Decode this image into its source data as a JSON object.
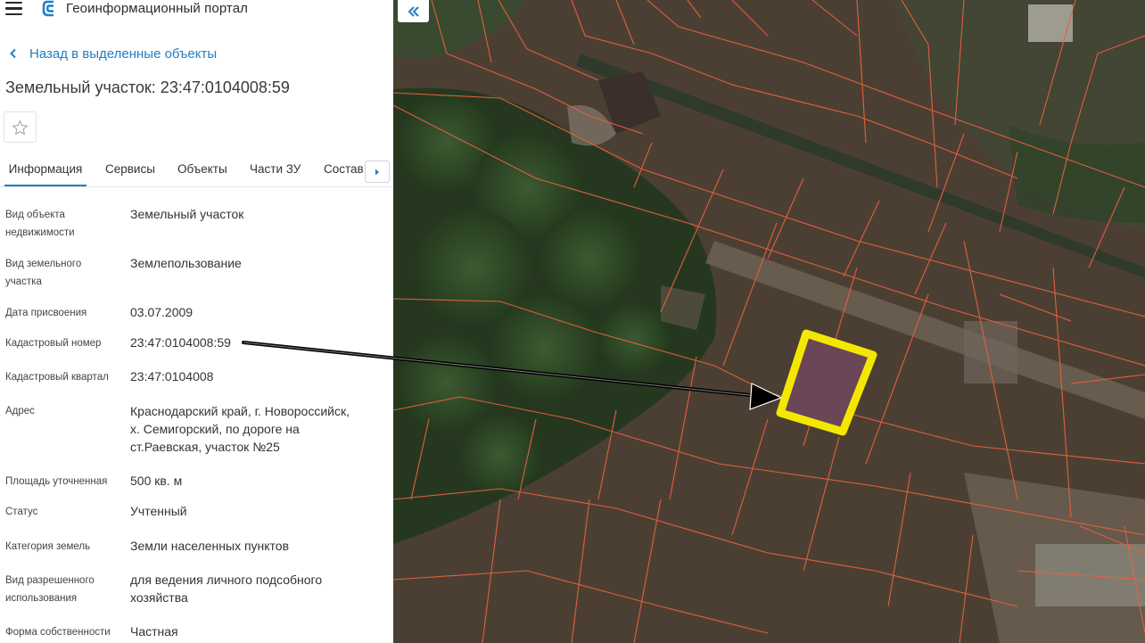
{
  "app": {
    "title": "Геоинформационный портал",
    "logo_icon": "portal-logo-icon",
    "menu_icon": "hamburger-menu-icon"
  },
  "nav": {
    "back_label": "Назад в выделенные объекты"
  },
  "object": {
    "title": "Земельный участок: 23:47:0104008:59"
  },
  "tabs": [
    {
      "label": "Информация",
      "active": true
    },
    {
      "label": "Сервисы"
    },
    {
      "label": "Объекты"
    },
    {
      "label": "Части ЗУ"
    },
    {
      "label": "Состав"
    }
  ],
  "info": {
    "kind": {
      "label_1": "Вид объекта",
      "label_2": "недвижимости",
      "value": "Земельный участок"
    },
    "type": {
      "label_1": "Вид земельного",
      "label_2": "участка",
      "value": "Землепользование"
    },
    "date": {
      "label": "Дата присвоения",
      "value": "03.07.2009"
    },
    "cad_number": {
      "label": "Кадастровый номер",
      "value": "23:47:0104008:59"
    },
    "cad_block": {
      "label": "Кадастровый квартал",
      "value": "23:47:0104008"
    },
    "address": {
      "label": "Адрес",
      "value_1": "Краснодарский край, г. Новороссийск,",
      "value_2": "х. Семигорский, по дороге на",
      "value_3": "ст.Раевская, участок №25"
    },
    "area": {
      "label": "Площадь уточненная",
      "value": "500 кв. м"
    },
    "status": {
      "label": "Статус",
      "value": "Учтенный"
    },
    "category": {
      "label": "Категория земель",
      "value": "Земли населенных пунктов"
    },
    "permitted_use": {
      "label_1": "Вид разрешенного",
      "label_2": "использования",
      "value_1": "для ведения личного подсобного",
      "value_2": "хозяйства"
    },
    "ownership": {
      "label": "Форма собственности",
      "value": "Частная"
    }
  },
  "colors": {
    "accent": "#1f7fc4",
    "parcel_lines": "#e8613e",
    "highlight_outline": "#f4e800",
    "highlight_fill": "#6b4656",
    "arrow": "#000000"
  },
  "icons": {
    "collapse": "double-chevron-left-icon",
    "star": "star-icon",
    "tab_next": "caret-right-icon"
  }
}
